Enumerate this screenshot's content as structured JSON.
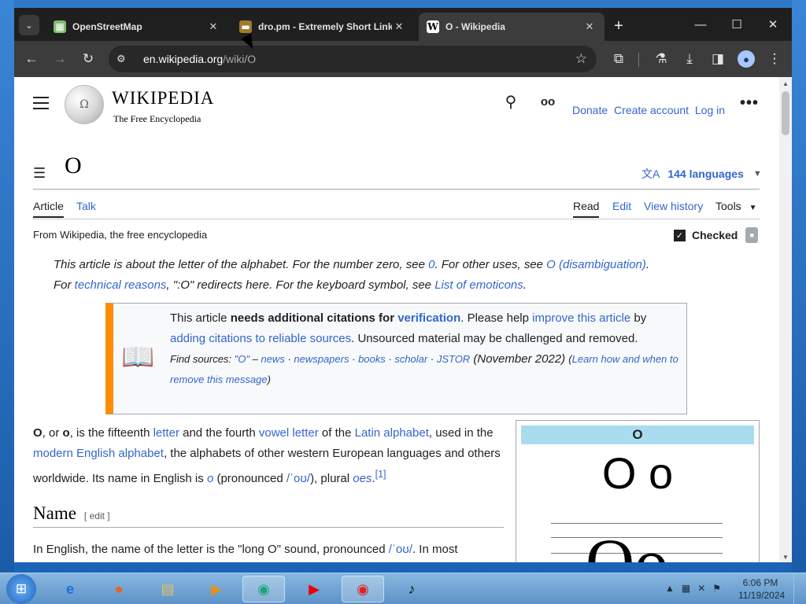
{
  "browser": {
    "tabs": [
      {
        "title": "OpenStreetMap",
        "favicon": "map-favicon",
        "active": false
      },
      {
        "title": "dro.pm - Extremely Short Links",
        "favicon": "dro-favicon",
        "active": false
      },
      {
        "title": "O - Wikipedia",
        "favicon": "wikipedia-favicon",
        "active": true
      }
    ],
    "new_tab": "+",
    "url_host": "en.wikipedia.org",
    "url_path": "/wiki/O"
  },
  "wiki": {
    "wordmark": "WIKIPEDIA",
    "tagline": "The Free Encyclopedia",
    "top_links": [
      "Donate",
      "Create account",
      "Log in"
    ],
    "title": "O",
    "languages": "144 languages",
    "page_tabs": [
      "Article",
      "Talk"
    ],
    "view_tabs": [
      "Read",
      "Edit",
      "View history",
      "Tools"
    ],
    "from": "From Wikipedia, the free encyclopedia",
    "checked": "Checked",
    "hatnote": {
      "t1": "This article is about the letter of the alphabet. For the number zero, see ",
      "l1": "0",
      "t2": ". For other uses, see ",
      "l2": "O (disambiguation)",
      "t3": ".",
      "t4": "For ",
      "l3": "technical reasons",
      "t5": ", \":O\" redirects here. For the keyboard symbol, see ",
      "l4": "List of emoticons",
      "t6": "."
    },
    "ambox": {
      "t1": "This article ",
      "b1": "needs additional citations for ",
      "l1": "verification",
      "t2": ". Please help ",
      "l2": "improve this article",
      "t3": "by ",
      "l3": "adding citations to reliable sources",
      "t4": ". Unsourced material may be challenged and removed.",
      "find": "Find sources: ",
      "q": "\"O\"",
      "dash": " – ",
      "sources": [
        "news",
        "newspapers",
        "books",
        "scholar",
        "JSTOR"
      ],
      "date": "(November 2022)",
      "learn": "Learn how and when to remove this message"
    },
    "intro": {
      "b1": "O",
      "t1": ", or ",
      "b2": "o",
      "t2": ", is the fifteenth ",
      "l1": "letter",
      "t3": " and the fourth ",
      "l2": "vowel letter",
      "t4": " of the ",
      "l3": "Latin alphabet",
      "t5": ", used in the ",
      "l4": "modern English alphabet",
      "t6": ", the alphabets of other western European languages and others worldwide. Its name in English is ",
      "i1": "o",
      "t7": " (pronounced ",
      "ipa": "/ˈoʊ/",
      "t8": "), plural ",
      "i2": "oes",
      "t9": ".",
      "ref": "[1]"
    },
    "section": {
      "title": "Name",
      "edit": "[ edit ]"
    },
    "section_text": {
      "t1": "In English, the name of the letter is the \"long O\" sound, pronounced ",
      "ipa": "/ˈoʊ/",
      "t2": ". In most"
    },
    "infobox": {
      "header": "O",
      "glyphs": "O o",
      "big": "Oo"
    }
  },
  "taskbar": {
    "clock_time": "6:06 PM",
    "clock_date": "11/19/2024",
    "apps": [
      "internet-explorer-icon",
      "firefox-icon",
      "file-explorer-icon",
      "media-player-icon",
      "chrome-dev-icon",
      "youtube-icon",
      "chrome-icon",
      "tiktok-icon"
    ]
  },
  "colors": {
    "link": "#3366cc",
    "ambox_stripe": "#ff8c00",
    "infobox_header": "#a8dcee",
    "browser_dark": "#3c3c3c"
  }
}
